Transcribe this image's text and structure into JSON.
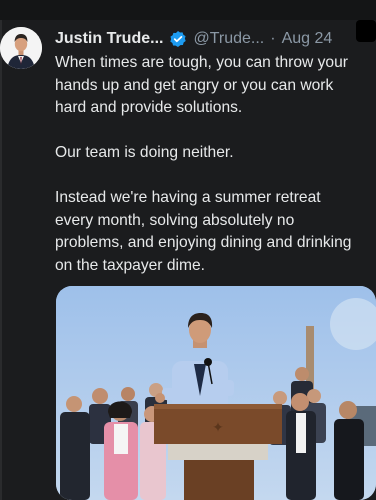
{
  "tweet": {
    "author_name": "Justin Trude...",
    "handle": "@Trude...",
    "separator": "·",
    "date": "Aug 24",
    "icons": {
      "avatar": "profile-photo",
      "verified": "verified-badge-icon",
      "more": "more-options-icon"
    },
    "colors": {
      "verified": "#1d9bf0",
      "text": "#e7e9ea",
      "secondary": "#8b98a5",
      "background": "#1b1c1e"
    },
    "lines": [
      "When times are tough, you can throw your",
      "hands up and get angry or you can work",
      "hard and provide solutions.",
      "",
      "Our team is doing neither.",
      "",
      "Instead we're having a summer retreat",
      "every month, solving absolutely no",
      "problems, and enjoying dining and drinking",
      "on the taxpayer dime."
    ],
    "media": {
      "description": "photo"
    }
  }
}
